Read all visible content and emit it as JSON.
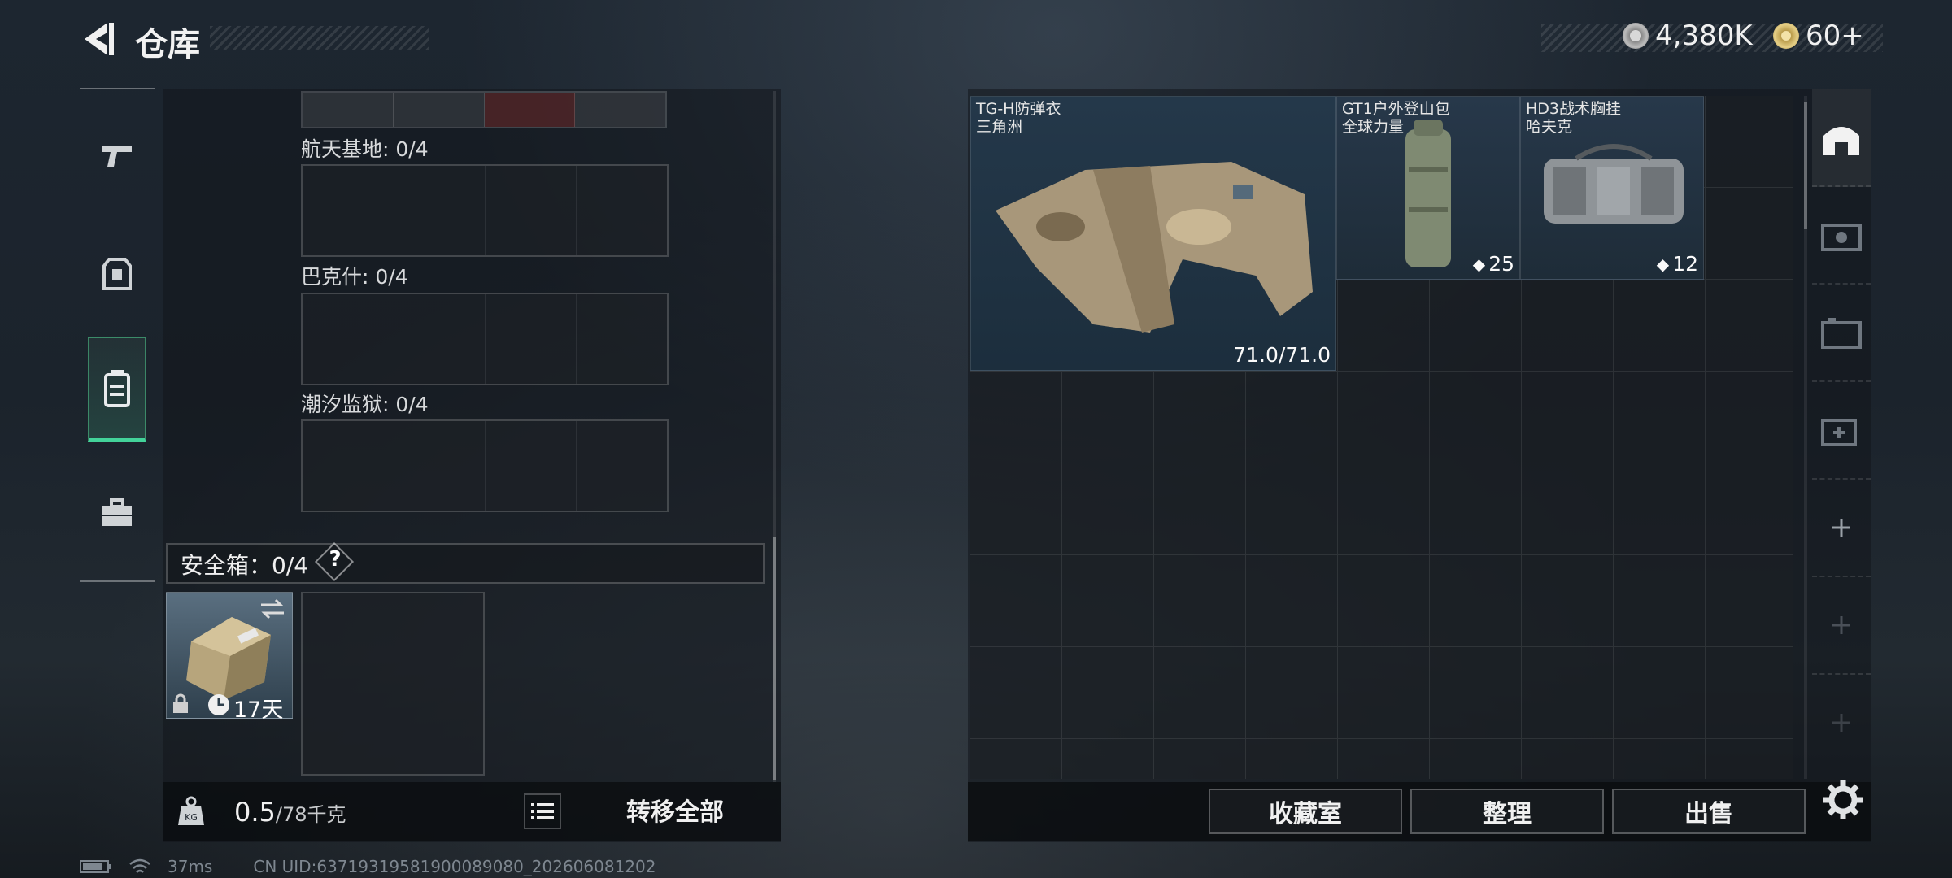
{
  "header": {
    "title": "仓库",
    "currency": "4,380K",
    "tickets": "60+"
  },
  "slots": [
    {
      "label": "航天基地: 0/4"
    },
    {
      "label": "巴克什: 0/4"
    },
    {
      "label": "潮汐监狱: 0/4"
    }
  ],
  "safe": {
    "label": "安全箱：0/4",
    "help": "?",
    "timer": "17天"
  },
  "bottom_left": {
    "weight": "0.5",
    "weight_max": "/78千克",
    "transfer_all": "转移全部"
  },
  "items": [
    {
      "name": "TG-H防弹衣",
      "sub": "三角洲",
      "value": "71.0/71.0"
    },
    {
      "name": "GT1户外登山包",
      "sub": "全球力量",
      "value": "25"
    },
    {
      "name": "HD3战术胸挂",
      "sub": "哈夫克",
      "value": "12"
    }
  ],
  "actions": {
    "collection": "收藏室",
    "sort": "整理",
    "sell": "出售"
  },
  "status": {
    "ping": "37ms",
    "uid": "CN UID:6371931958190008​9080_202606081202"
  }
}
